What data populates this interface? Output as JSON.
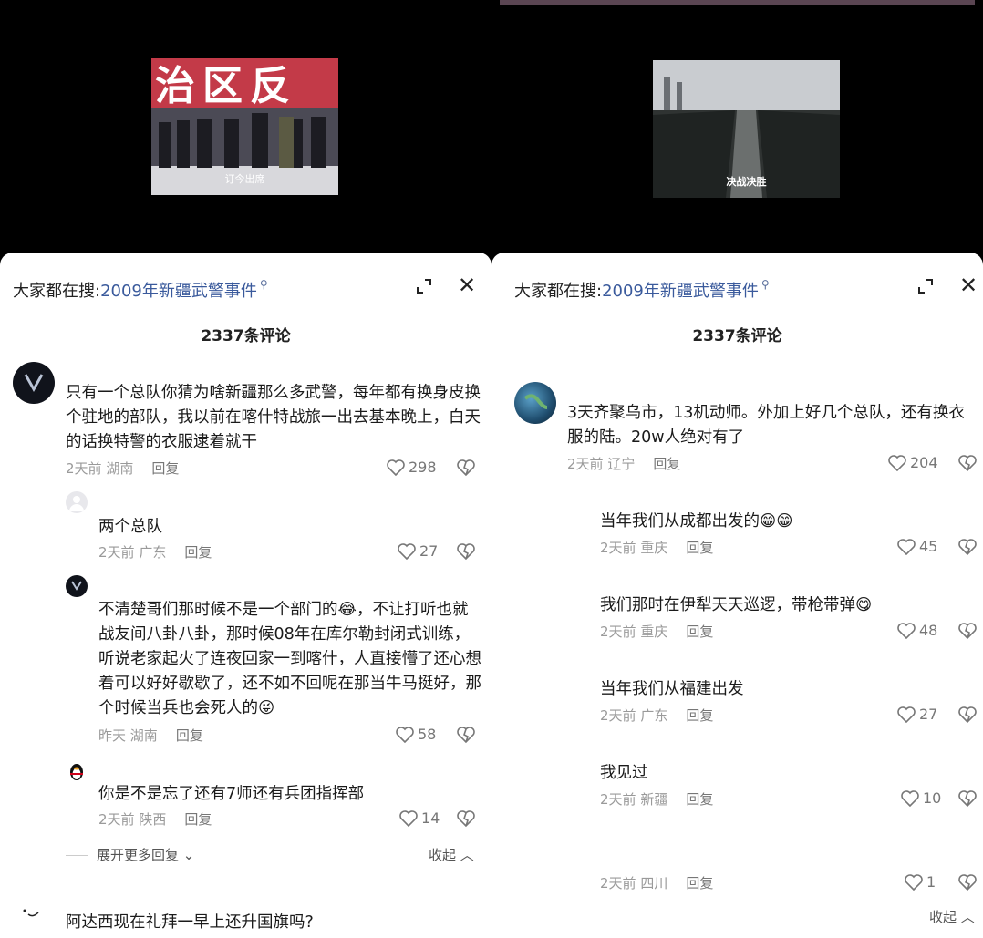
{
  "left": {
    "video": {
      "banner": "治区反",
      "caption": "订今出席"
    },
    "search": {
      "prefix": "大家都在搜:",
      "term": "2009年新疆武警事件"
    },
    "comment_count": "2337条评论",
    "comments": [
      {
        "text": "只有一个总队你猜为啥新疆那么多武警，每年都有换身皮换个驻地的部队，我以前在喀什特战旅一出去基本晚上，白天的话换特警的衣服逮着就干",
        "time": "2天前",
        "loc": "湖南",
        "reply": "回复",
        "likes": "298"
      },
      {
        "text": "两个总队",
        "time": "2天前",
        "loc": "广东",
        "reply": "回复",
        "likes": "27"
      },
      {
        "text": "不清楚哥们那时候不是一个部门的😂，不让打听也就战友间八卦八卦，那时候08年在库尔勒封闭式训练，听说老家起火了连夜回家一到喀什，人直接懵了还心想着可以好好歇歇了，还不如不回呢在那当牛马挺好，那个时候当兵也会死人的😜",
        "time": "昨天",
        "loc": "湖南",
        "reply": "回复",
        "likes": "58"
      },
      {
        "text": "你是不是忘了还有7师还有兵团指挥部",
        "time": "2天前",
        "loc": "陕西",
        "reply": "回复",
        "likes": "14"
      },
      {
        "text": "阿达西现在礼拜一早上还升国旗吗?"
      }
    ],
    "expand_more": "展开更多回复",
    "collapse": "收起"
  },
  "right": {
    "video": {
      "caption": "决战决胜"
    },
    "search": {
      "prefix": "大家都在搜:",
      "term": "2009年新疆武警事件"
    },
    "comment_count": "2337条评论",
    "comments": [
      {
        "text": "3天齐聚乌市，13机动师。外加上好几个总队，还有换衣服的陆。20w人绝对有了",
        "time": "2天前",
        "loc": "辽宁",
        "reply": "回复",
        "likes": "204"
      },
      {
        "text": "当年我们从成都出发的😁😁",
        "time": "2天前",
        "loc": "重庆",
        "reply": "回复",
        "likes": "45"
      },
      {
        "text": "我们那时在伊犁天天巡逻，带枪带弹😋",
        "time": "2天前",
        "loc": "重庆",
        "reply": "回复",
        "likes": "48"
      },
      {
        "text": "当年我们从福建出发",
        "time": "2天前",
        "loc": "广东",
        "reply": "回复",
        "likes": "27"
      },
      {
        "text": "我见过",
        "time": "2天前",
        "loc": "新疆",
        "reply": "回复",
        "likes": "10"
      },
      {
        "time": "2天前",
        "loc": "四川",
        "reply": "回复",
        "likes": "1"
      }
    ],
    "collapse": "收起"
  }
}
